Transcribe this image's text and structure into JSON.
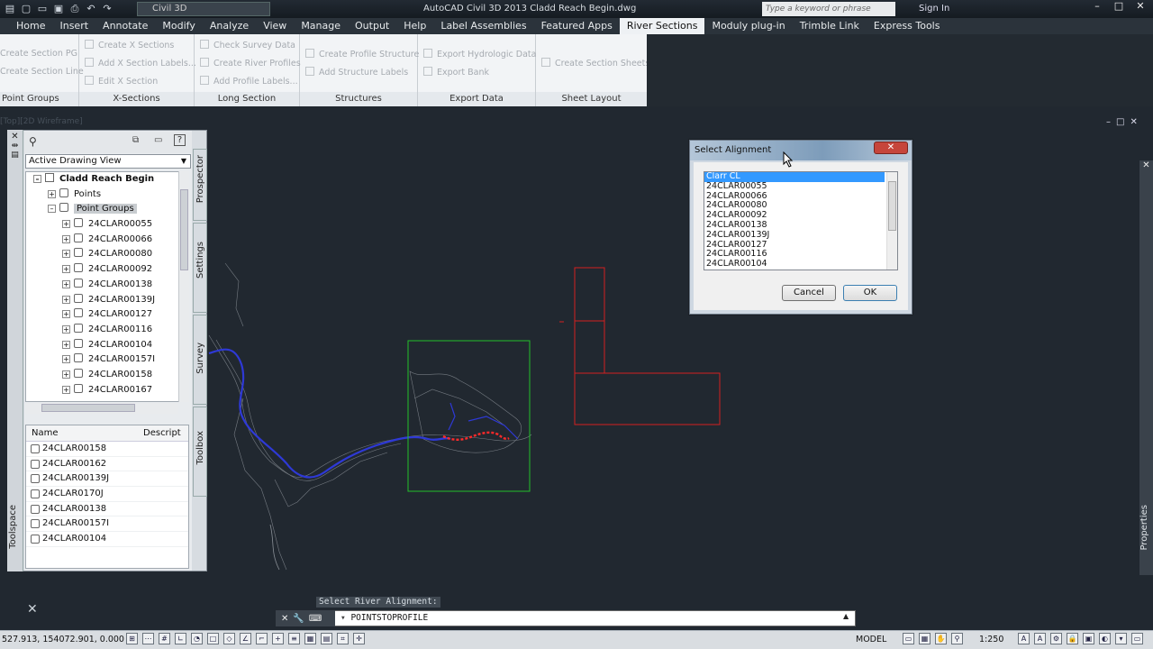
{
  "title_bar": {
    "workspace": "Civil 3D",
    "window_title": "AutoCAD Civil 3D 2013    Cladd Reach Begin.dwg",
    "search_placeholder": "Type a keyword or phrase",
    "sign_in": "Sign In"
  },
  "menu_tabs": [
    "Home",
    "Insert",
    "Annotate",
    "Modify",
    "Analyze",
    "View",
    "Manage",
    "Output",
    "Help",
    "Label Assemblies",
    "Featured Apps",
    "River Sections",
    "Moduly plug-in",
    "Trimble Link",
    "Express Tools"
  ],
  "active_tab": "River Sections",
  "ribbon": {
    "point_groups": {
      "title": "Point Groups",
      "buttons": [
        "Create Section PG",
        "Create Section Line"
      ]
    },
    "x_sections": {
      "title": "X-Sections",
      "buttons": [
        "Create X Sections",
        "Add X Section Labels...",
        "Edit X Section"
      ]
    },
    "long_section": {
      "title": "Long Section",
      "buttons": [
        "Check Survey Data",
        "Create River Profiles",
        "Add Profile Labels..."
      ]
    },
    "structures": {
      "title": "Structures",
      "buttons": [
        "Create Profile Structure",
        "Add Structure Labels"
      ]
    },
    "export_data": {
      "title": "Export Data",
      "buttons": [
        "Export Hydrologic Data",
        "Export Bank"
      ]
    },
    "sheet_layout": {
      "title": "Sheet Layout",
      "buttons": [
        "Create Section Sheets"
      ]
    }
  },
  "viewport_label": "[Top][2D Wireframe]",
  "toolspace": {
    "label": "Toolspace",
    "view_select": "Active Drawing View",
    "tree_root": "Cladd Reach Begin",
    "tree_points": "Points",
    "tree_point_groups": "Point Groups",
    "tree_items": [
      "24CLAR00055",
      "24CLAR00066",
      "24CLAR00080",
      "24CLAR00092",
      "24CLAR00138",
      "24CLAR00139J",
      "24CLAR00127",
      "24CLAR00116",
      "24CLAR00104",
      "24CLAR00157I",
      "24CLAR00158",
      "24CLAR00167"
    ],
    "list_headers": {
      "name": "Name",
      "description": "Descript"
    },
    "list_items": [
      "24CLAR00158",
      "24CLAR00162",
      "24CLAR00139J",
      "24CLAR0170J",
      "24CLAR00138",
      "24CLAR00157I",
      "24CLAR00104"
    ],
    "side_tabs": [
      "Prospector",
      "Settings",
      "Survey",
      "Toolbox"
    ]
  },
  "properties_label": "Properties",
  "dialog": {
    "title": "Select Alignment",
    "items": [
      "Clarr CL",
      "24CLAR00055",
      "24CLAR00066",
      "24CLAR00080",
      "24CLAR00092",
      "24CLAR00138",
      "24CLAR00139J",
      "24CLAR00127",
      "24CLAR00116",
      "24CLAR00104"
    ],
    "selected": "Clarr CL",
    "cancel": "Cancel",
    "ok": "OK"
  },
  "command": {
    "prompt": "Select River Alignment:",
    "input": "POINTSTOPROFILE"
  },
  "status_bar": {
    "coords": "527.913, 154072.901, 0.000",
    "model": "MODEL",
    "scale": "1:250"
  },
  "colors": {
    "canvas": "#212830",
    "river": "#2e39d6",
    "selection_box": "#22c02a",
    "red_entities": "#d42020",
    "dialog_selection": "#3399ff"
  }
}
